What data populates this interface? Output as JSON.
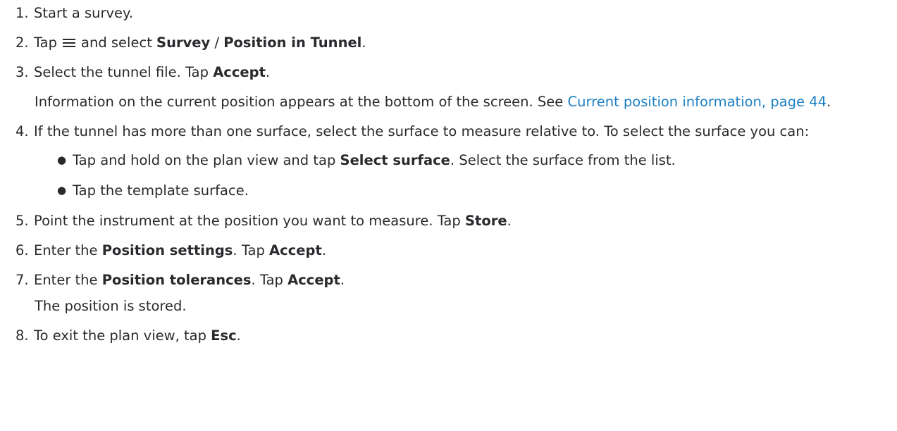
{
  "steps": [
    {
      "num": "1.",
      "parts": [
        "Start a survey."
      ]
    },
    {
      "num": "2.",
      "parts": [
        "Tap",
        "and select",
        "Survey",
        "/",
        "Position in Tunnel",
        "."
      ],
      "icon": "menu-icon"
    },
    {
      "num": "3.",
      "parts": [
        "Select the tunnel file. Tap",
        "Accept",
        "."
      ]
    },
    {
      "num": "4.",
      "parts": [
        "If the tunnel has more than one surface, select the surface to measure relative to. To select the surface you can:"
      ]
    },
    {
      "num": "5.",
      "parts": [
        "Point the instrument at the position you want to measure. Tap",
        "Store",
        "."
      ]
    },
    {
      "num": "6.",
      "parts": [
        "Enter the",
        "Position settings",
        ". Tap",
        "Accept",
        "."
      ]
    },
    {
      "num": "7.",
      "parts": [
        "Enter the",
        "Position tolerances",
        ". Tap",
        "Accept",
        "."
      ]
    },
    {
      "num": "8.",
      "parts": [
        "To exit the plan view, tap",
        "Esc",
        "."
      ]
    }
  ],
  "notes": {
    "step3": {
      "text": "Information on the current position appears at the bottom of the screen. See",
      "link": "Current position information, page 44",
      "end": "."
    },
    "step7": {
      "text": "The position is stored."
    }
  },
  "bullets": [
    {
      "parts": [
        "Tap and hold on the plan view and tap",
        "Select surface",
        ". Select the surface from the list."
      ]
    },
    {
      "parts": [
        "Tap the template surface."
      ]
    }
  ],
  "colors": {
    "text": "#2a2a2e",
    "link": "#1c7fc4"
  }
}
